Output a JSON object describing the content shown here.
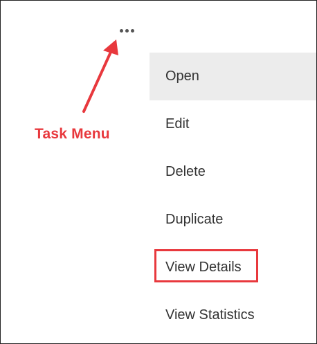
{
  "task_menu_button": {
    "icon": "more-horizontal-icon"
  },
  "annotation": {
    "label": "Task Menu",
    "color": "#e8383d"
  },
  "menu": {
    "items": [
      {
        "label": "Open"
      },
      {
        "label": "Edit"
      },
      {
        "label": "Delete"
      },
      {
        "label": "Duplicate"
      },
      {
        "label": "View Details"
      },
      {
        "label": "View Statistics"
      }
    ],
    "active_index": 0,
    "highlighted_item": "View Details"
  }
}
